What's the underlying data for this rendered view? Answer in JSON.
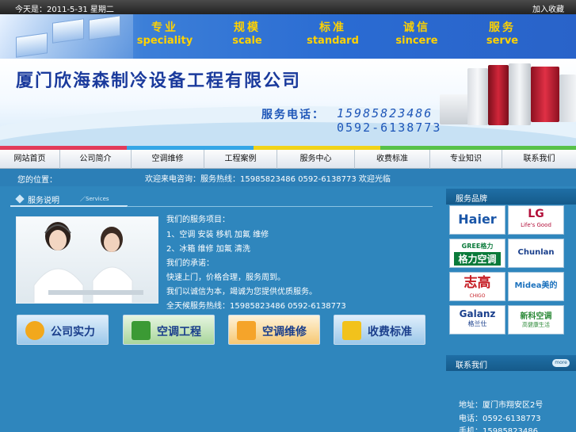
{
  "topbar": {
    "date_text": "今天是：2011-5-31 星期二",
    "favorite": "加入收藏"
  },
  "banner": {
    "slogans": [
      {
        "zh": "专业",
        "en": "speciality"
      },
      {
        "zh": "规模",
        "en": "scale"
      },
      {
        "zh": "标准",
        "en": "standard"
      },
      {
        "zh": "诚信",
        "en": "sincere"
      },
      {
        "zh": "服务",
        "en": "serve"
      }
    ],
    "company_name": "厦门欣海森制冷设备工程有限公司",
    "phone_label": "服务电话：",
    "phone1": "15985823486",
    "phone2": "0592-6138773"
  },
  "nav": [
    "网站首页",
    "公司简介",
    "空调维修",
    "工程案例",
    "服务中心",
    "收费标准",
    "专业知识",
    "联系我们"
  ],
  "notice": {
    "home": "您的位置：",
    "text": "欢迎来电咨询：服务热线：15985823486  0592-6138773    欢迎光临"
  },
  "section": {
    "title": "服务说明",
    "subtitle": "／Services"
  },
  "description": [
    "我们的服务项目：",
    "1、空调 安装 移机 加氟 维修",
    "2、冰箱 维修 加氟 清洗",
    "我们的承诺：",
    "快速上门，价格合理，服务周到。",
    "我们以诚信为本，竭诚为您提供优质服务。",
    "全天候服务热线：15985823486 0592-6138773"
  ],
  "features": [
    {
      "label": "公司实力",
      "color": "#f2a81c"
    },
    {
      "label": "空调工程",
      "color": "#3b9a34"
    },
    {
      "label": "空调维修",
      "color": "#f5a42a"
    },
    {
      "label": "收费标准",
      "color": "#f2c21c"
    }
  ],
  "sidebar": {
    "brands_title": "服务品牌",
    "brands": [
      {
        "name": "Haier",
        "sub": "",
        "color": "#1a56a8",
        "icon": "haier-logo"
      },
      {
        "name": "LG",
        "sub": "Life's Good",
        "color": "#b30f3a",
        "icon": "lg-logo"
      },
      {
        "name": "GREE格力",
        "sub": "格力空调",
        "color": "#0a7a3a",
        "icon": "gree-logo"
      },
      {
        "name": "Chunlan",
        "sub": "",
        "color": "#1a3f8c",
        "icon": "chunlan-logo"
      },
      {
        "name": "志高",
        "sub": "CHIGO",
        "color": "#c51d24",
        "icon": "chigo-logo"
      },
      {
        "name": "Midea美的",
        "sub": "",
        "color": "#1e73be",
        "icon": "midea-logo"
      },
      {
        "name": "Galanz",
        "sub": "格兰仕",
        "color": "#1a3f8c",
        "icon": "galanz-logo"
      },
      {
        "name": "新科空调",
        "sub": "高健康生活",
        "color": "#2e8b3a",
        "icon": "shinco-logo"
      }
    ],
    "contact_title": "联系我们",
    "more": "more",
    "contact_lines": [
      "地址：厦门市翔安区2号",
      "电话：0592-6138773",
      "手机：15985823486"
    ]
  }
}
